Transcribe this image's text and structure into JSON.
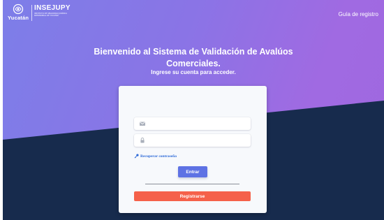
{
  "brand": {
    "logo_text": "Yucatán",
    "name": "INSEJUPY",
    "subtitle": "INSTITUTO DE SEGURIDAD JURÍDICA PATRIMONIAL DE YUCATÁN"
  },
  "nav": {
    "registration_guide": "Guía de registro"
  },
  "hero": {
    "welcome_line1": "Bienvenido al Sistema de Validación de Avalúos",
    "welcome_line2": "Comerciales.",
    "subtitle": "Ingrese su cuenta para acceder."
  },
  "login": {
    "email_placeholder": "",
    "password_placeholder": "",
    "recover_label": "Recuperar contraseña",
    "enter_label": "Entrar",
    "register_label": "Registrarse"
  },
  "colors": {
    "gradient_start": "#7d7ee8",
    "gradient_end": "#a06ae2",
    "dark_section": "#172b4d",
    "primary_button": "#5e72e4",
    "register_button": "#f5614a",
    "link": "#2f6bd8"
  },
  "icons": {
    "email": "envelope-icon",
    "password": "lock-icon",
    "recover": "key-icon"
  }
}
